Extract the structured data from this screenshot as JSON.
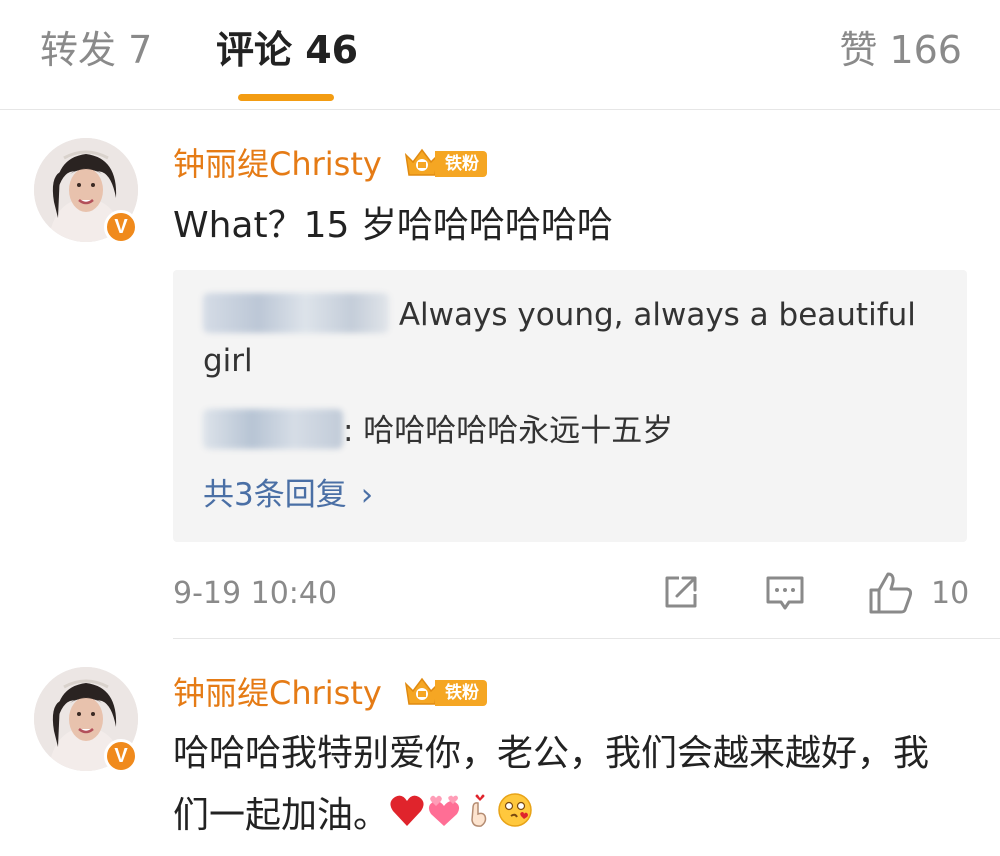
{
  "tabs": {
    "repost": "转发 7",
    "comment": "评论 46",
    "like": "赞 166"
  },
  "comments": [
    {
      "username": "钟丽缇Christy",
      "fan_badge": "铁粉",
      "verified_mark": "V",
      "text": "What？15 岁哈哈哈哈哈哈",
      "replies": [
        {
          "text": " Always young, always a beautiful girl"
        },
        {
          "text": ": 哈哈哈哈哈永远十五岁"
        }
      ],
      "more_replies": "共3条回复",
      "timestamp": "9-19 10:40",
      "like_count": "10"
    },
    {
      "username": "钟丽缇Christy",
      "fan_badge": "铁粉",
      "verified_mark": "V",
      "text": "哈哈哈我特别爱你，老公，我们会越来越好，我们一起加油。",
      "emojis": [
        "heart-icon",
        "hearts-icon",
        "finger-heart-icon",
        "kiss-face-icon"
      ]
    }
  ],
  "colors": {
    "accent": "#f39c12",
    "username": "#e57b15",
    "link": "#4a6fa5",
    "muted": "#8a8a8a"
  }
}
